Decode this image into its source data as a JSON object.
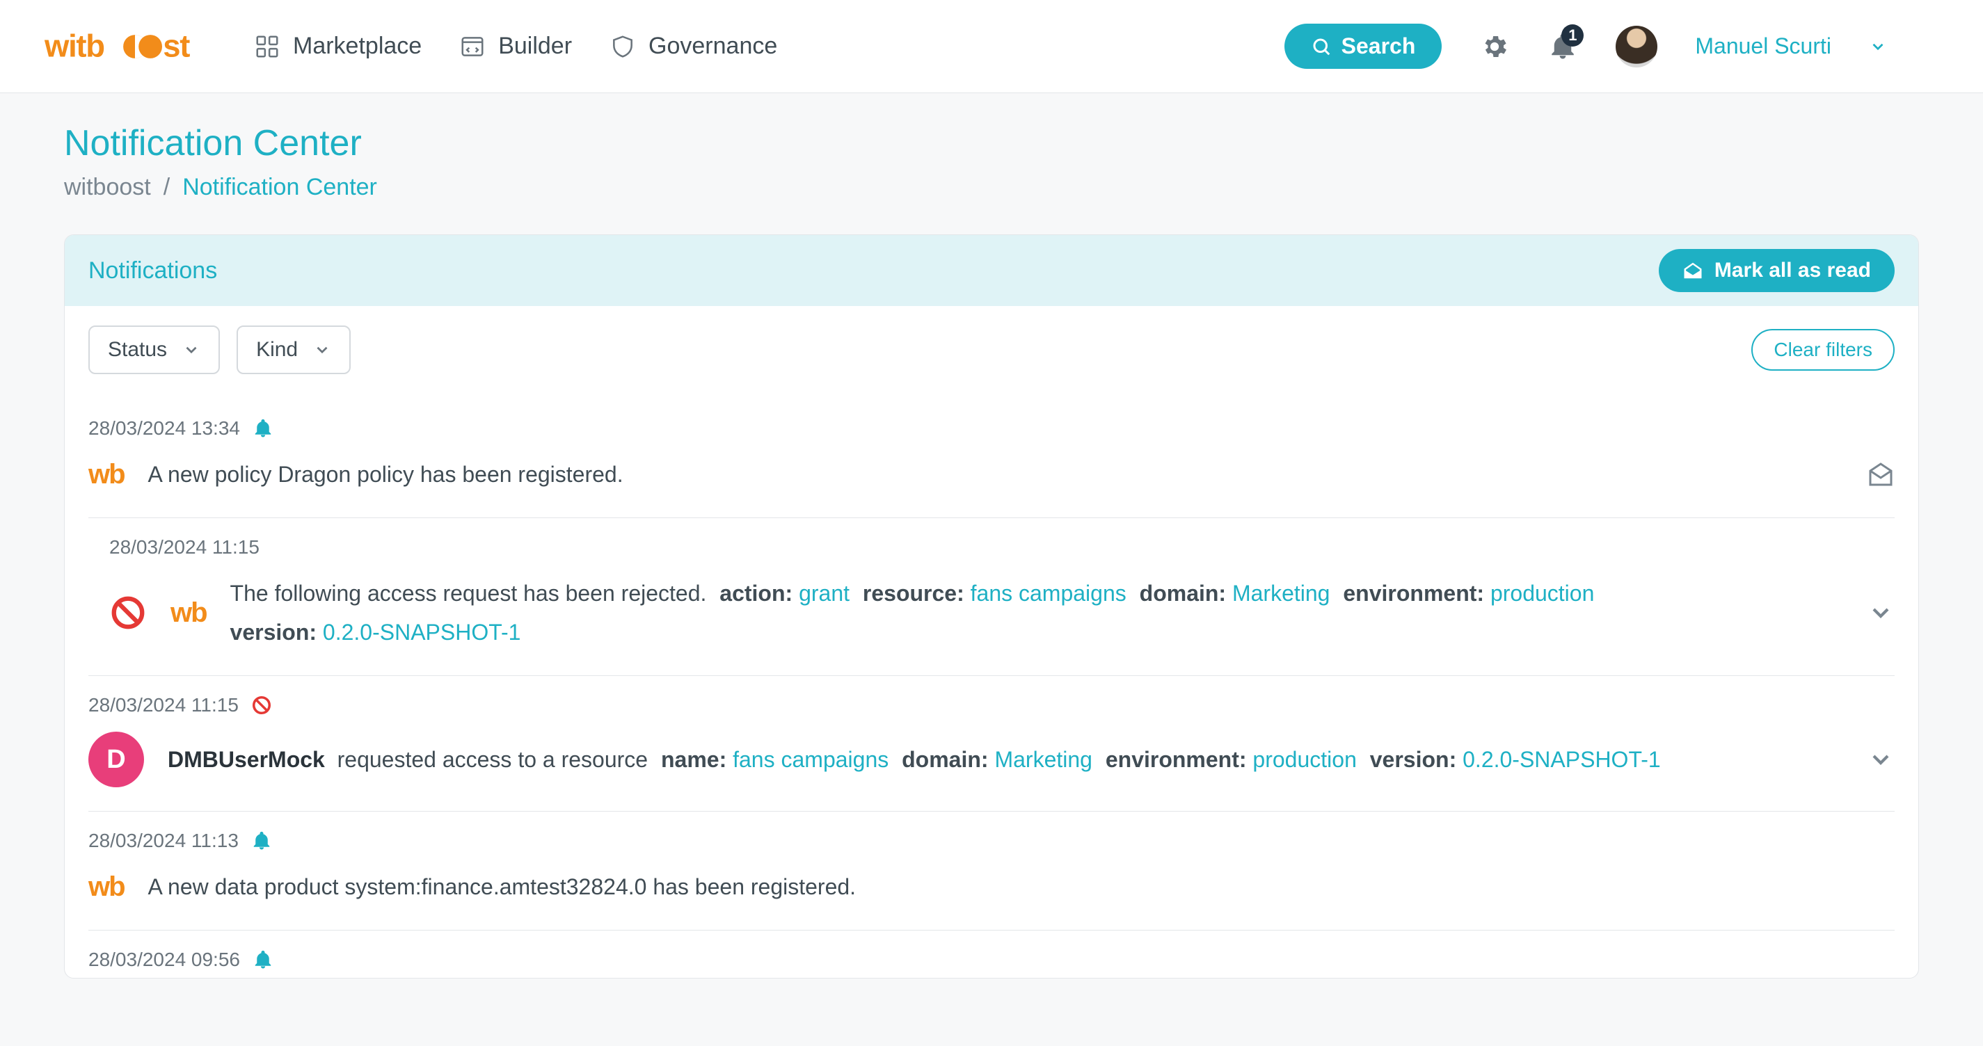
{
  "app_name": "witboost",
  "nav": {
    "marketplace": "Marketplace",
    "builder": "Builder",
    "governance": "Governance"
  },
  "search_label": "Search",
  "bell_badge": "1",
  "user_name": "Manuel Scurti",
  "page": {
    "title": "Notification Center",
    "crumb_root": "witboost",
    "crumb_sep": "/",
    "crumb_current": "Notification Center"
  },
  "card": {
    "title": "Notifications",
    "mark_all": "Mark all as read",
    "filter_status": "Status",
    "filter_kind": "Kind",
    "clear_filters": "Clear filters"
  },
  "wb_badge_text": "wb",
  "notifs": {
    "0": {
      "ts": "28/03/2024 13:34",
      "text": "A new policy Dragon policy has been registered."
    },
    "1": {
      "ts": "28/03/2024 11:15",
      "lead": "The following access request has been rejected.",
      "action_k": "action:",
      "action_v": "grant",
      "resource_k": "resource:",
      "resource_v": "fans campaigns",
      "domain_k": "domain:",
      "domain_v": "Marketing",
      "env_k": "environment:",
      "env_v": "production",
      "version_k": "version:",
      "version_v": "0.2.0-SNAPSHOT-1"
    },
    "2": {
      "ts": "28/03/2024 11:15",
      "avatar_letter": "D",
      "actor": "DMBUserMock",
      "lead": "requested access to a resource",
      "name_k": "name:",
      "name_v": "fans campaigns",
      "domain_k": "domain:",
      "domain_v": "Marketing",
      "env_k": "environment:",
      "env_v": "production",
      "version_k": "version:",
      "version_v": "0.2.0-SNAPSHOT-1"
    },
    "3": {
      "ts": "28/03/2024 11:13",
      "text": "A new data product system:finance.amtest32824.0 has been registered."
    },
    "4": {
      "ts": "28/03/2024 09:56"
    }
  }
}
